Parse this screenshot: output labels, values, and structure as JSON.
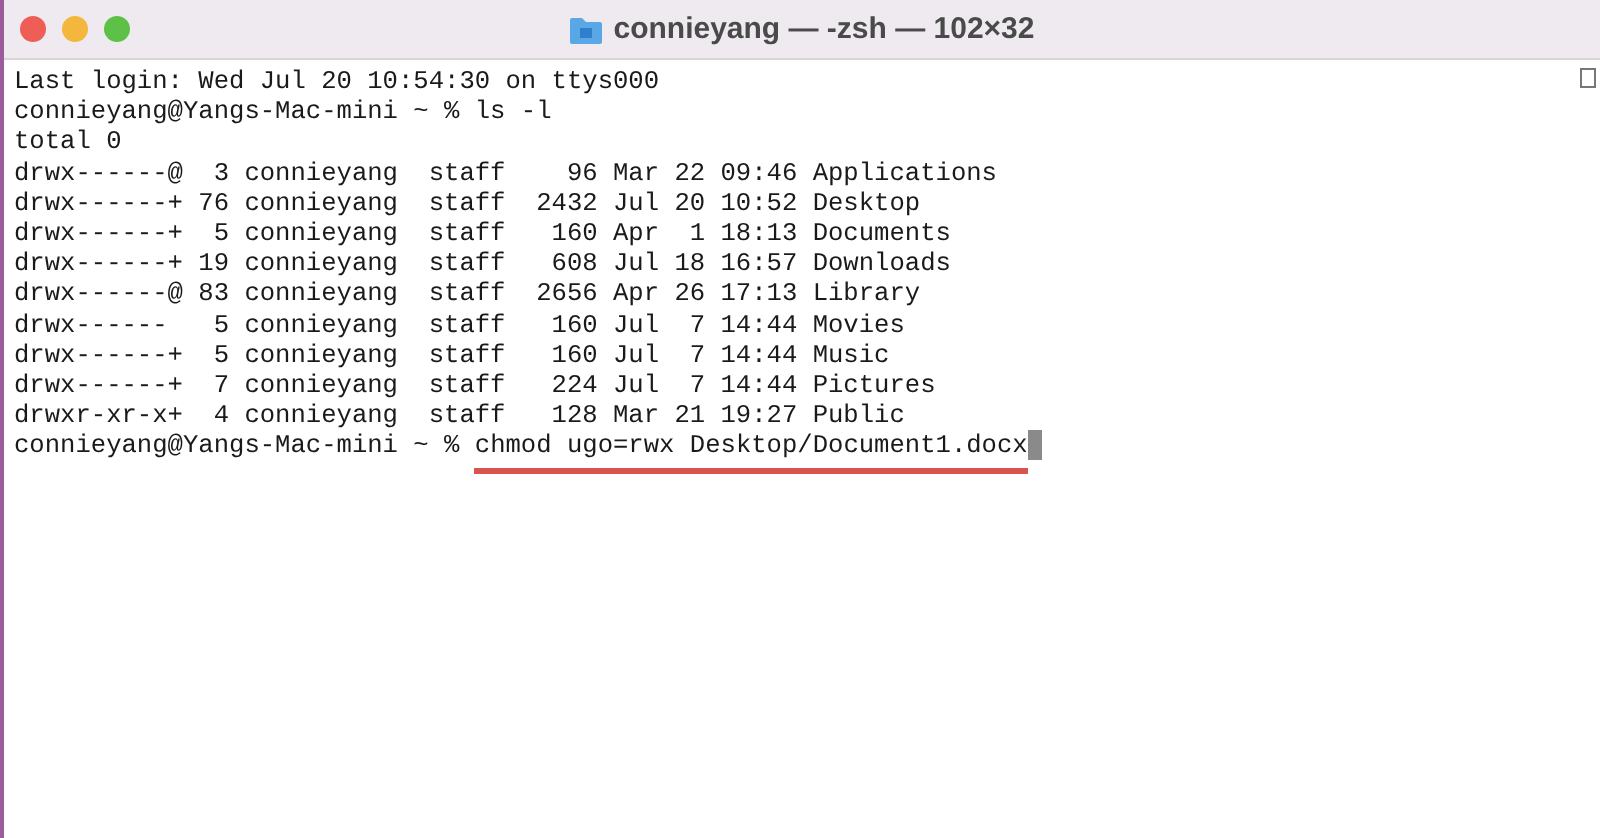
{
  "window": {
    "title": "connieyang — -zsh — 102×32"
  },
  "terminal": {
    "lines": [
      {
        "text": "Last login: Wed Jul 20 10:54:30 on ttys000"
      },
      {
        "text": "connieyang@Yangs-Mac-mini ~ % ls -l"
      },
      {
        "text": "total 0"
      },
      {
        "text": "drwx------@  3 connieyang  staff    96 Mar 22 09:46 Applications"
      },
      {
        "text": "drwx------+ 76 connieyang  staff  2432 Jul 20 10:52 Desktop"
      },
      {
        "text": "drwx------+  5 connieyang  staff   160 Apr  1 18:13 Documents"
      },
      {
        "text": "drwx------+ 19 connieyang  staff   608 Jul 18 16:57 Downloads"
      },
      {
        "text": "drwx------@ 83 connieyang  staff  2656 Apr 26 17:13 Library"
      },
      {
        "text": "drwx------   5 connieyang  staff   160 Jul  7 14:44 Movies"
      },
      {
        "text": "drwx------+  5 connieyang  staff   160 Jul  7 14:44 Music"
      },
      {
        "text": "drwx------+  7 connieyang  staff   224 Jul  7 14:44 Pictures"
      },
      {
        "text": "drwxr-xr-x+  4 connieyang  staff   128 Mar 21 19:27 Public"
      }
    ],
    "prompt": "connieyang@Yangs-Mac-mini ~ %",
    "command": "chmod ugo=rwx Desktop/Document1.docx",
    "command_underlined": true,
    "cursor": true
  }
}
